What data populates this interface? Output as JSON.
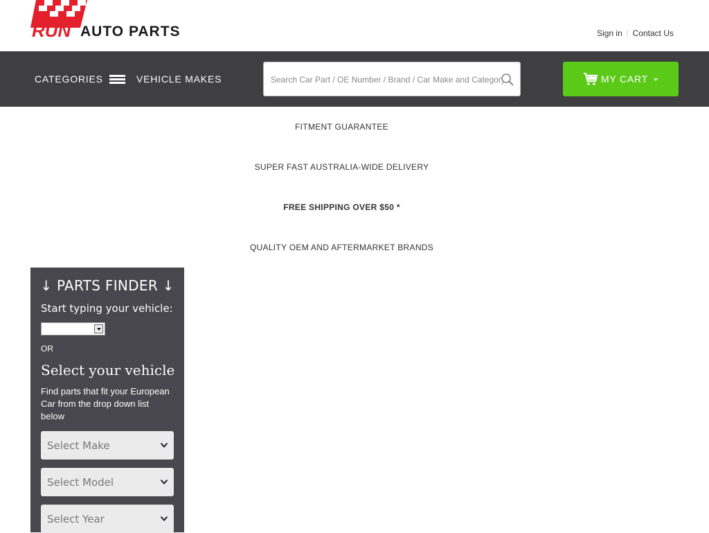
{
  "header": {
    "logo": {
      "text_a": "RUN",
      "text_b": "AUTO PARTS",
      "brand_red": "#e3202b",
      "brand_dark": "#1b1b1b"
    },
    "links": {
      "sign_in": "Sign in",
      "contact_us": "Contact Us"
    }
  },
  "navbar": {
    "background": "#3f3f41",
    "categories_label": "CATEGORIES",
    "vehicle_makes_label": "VEHICLE MAKES",
    "search": {
      "placeholder": "Search Car Part / OE Number / Brand / Car Make and Category"
    },
    "cart": {
      "label": "MY CART",
      "color": "#5ac918"
    }
  },
  "promos": [
    {
      "text": "FITMENT GUARANTEE",
      "bold": false
    },
    {
      "text": "SUPER FAST AUSTRALIA-WIDE DELIVERY",
      "bold": false
    },
    {
      "text": "FREE SHIPPING OVER $50 *",
      "bold": true
    },
    {
      "text": "QUALITY OEM AND AFTERMARKET BRANDS",
      "bold": false
    }
  ],
  "parts_finder": {
    "title": "↓ PARTS FINDER ↓",
    "typing_label": "Start typing your vehicle:",
    "or_label": "OR",
    "select_heading": "Select your vehicle",
    "description": "Find parts that fit your European Car from the drop down list below",
    "selects": {
      "make": "Select Make",
      "model": "Select Model",
      "year": "Select Year"
    },
    "background": "#47474d"
  }
}
